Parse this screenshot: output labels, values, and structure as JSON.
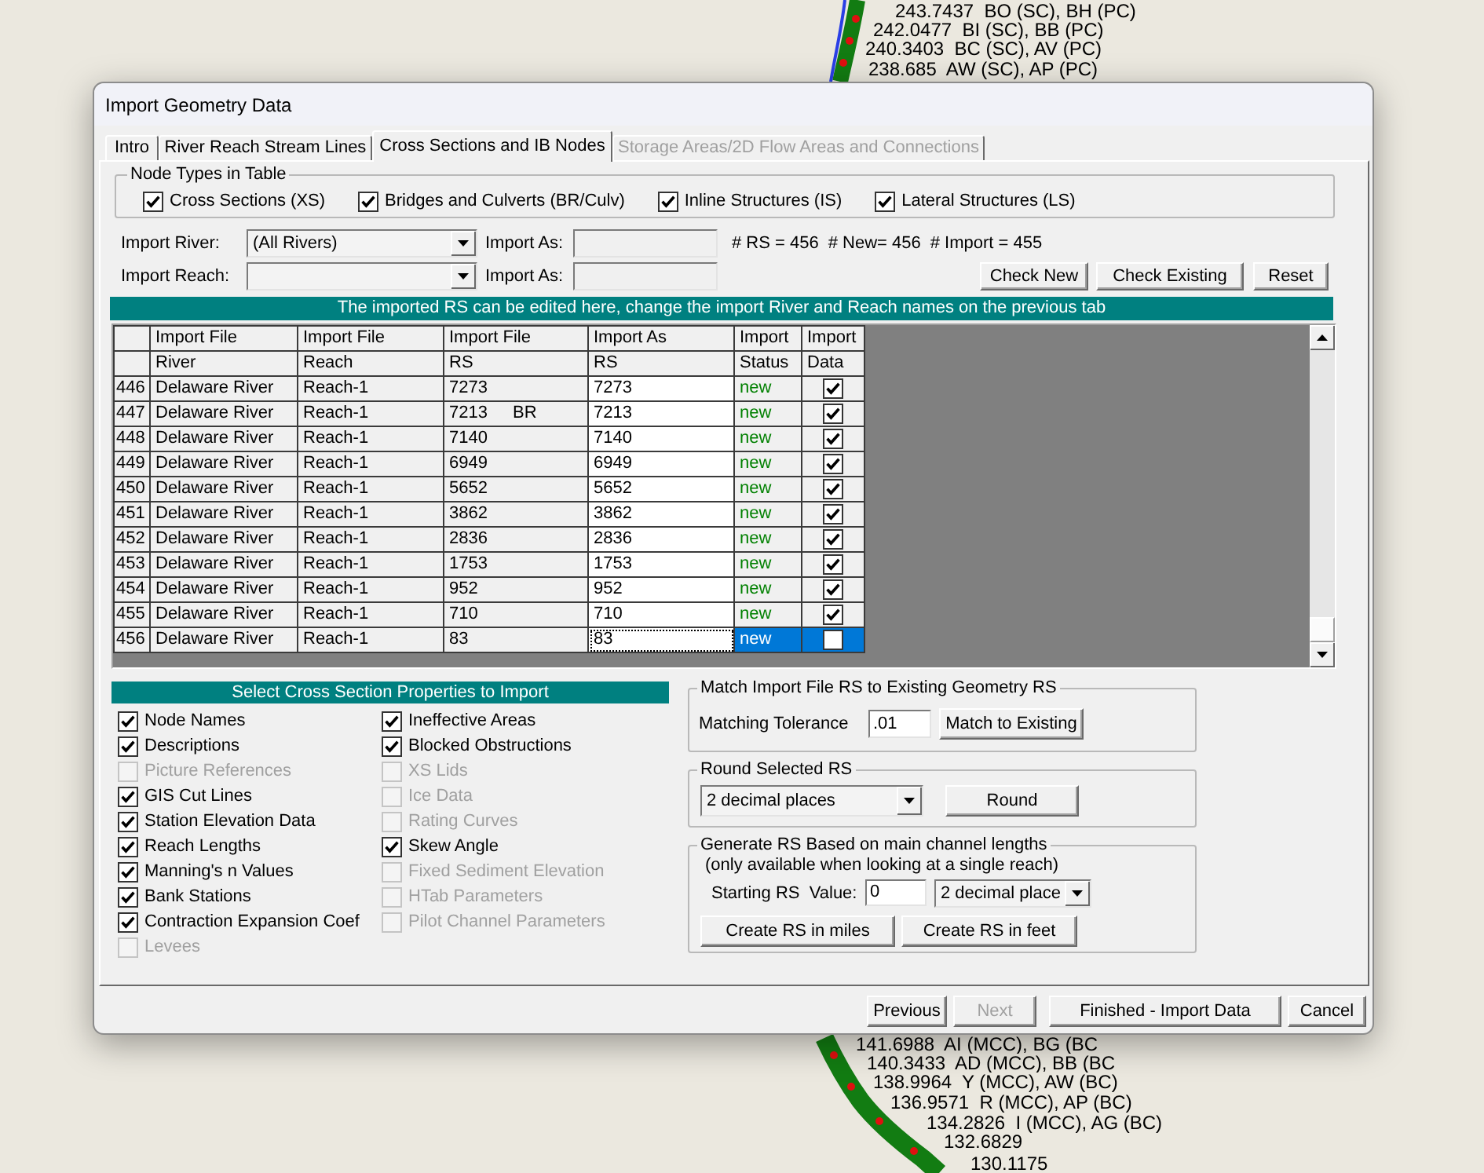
{
  "map": {
    "station_labels": [
      "243.7437  BO (SC), BH (PC)",
      "242.0477  BI (SC), BB (PC)",
      "240.3403  BC (SC), AV (PC)",
      "238.685  AW (SC), AP (PC)",
      "141.6988  AI (MCC), BG (BC",
      "140.3433  AD (MCC), BB (BC",
      "138.9964  Y (MCC), AW (BC)",
      "136.9571  R (MCC), AP (BC)",
      "134.2826  I (MCC), AG (BC)",
      "132.6829",
      "130.1175"
    ]
  },
  "window": {
    "title": "Import Geometry Data"
  },
  "tabs": [
    {
      "label": "Intro",
      "selected": false,
      "disabled": false
    },
    {
      "label": "River Reach Stream Lines",
      "selected": false,
      "disabled": false
    },
    {
      "label": "Cross Sections and IB Nodes",
      "selected": true,
      "disabled": false
    },
    {
      "label": "Storage Areas/2D Flow Areas and Connections",
      "selected": false,
      "disabled": true
    }
  ],
  "node_types": {
    "title": "Node Types in Table",
    "items": [
      {
        "label": "Cross Sections (XS)",
        "checked": true
      },
      {
        "label": "Bridges and Culverts (BR/Culv)",
        "checked": true
      },
      {
        "label": "Inline Structures (IS)",
        "checked": true
      },
      {
        "label": "Lateral Structures (LS)",
        "checked": true
      }
    ]
  },
  "import_river": {
    "label": "Import River:",
    "value": "(All Rivers)",
    "import_as": {
      "label": "Import As:",
      "disabled": true
    }
  },
  "import_reach": {
    "label": "Import Reach:",
    "import_as": {
      "label": "Import As:",
      "disabled": true
    }
  },
  "counts": [
    "# RS = 456",
    "# New= 456",
    "# Import = 455"
  ],
  "action_buttons": [
    "Check New",
    "Check Existing",
    "Reset"
  ],
  "table": {
    "banner": "The imported RS can be edited here, change the import River and Reach names on the previous tab",
    "header_rows": [
      [
        "Import File",
        "Import File",
        "Import File",
        "Import As",
        "Import",
        "Import"
      ],
      [
        "River",
        "Reach",
        "RS",
        "RS",
        "Status",
        "Data"
      ]
    ],
    "rows": [
      {
        "number": "446",
        "river": "Delaware River",
        "reach": "Reach-1",
        "rs": "7273",
        "import_as": "7273",
        "status": "new",
        "import": true,
        "selected": false
      },
      {
        "number": "447",
        "river": "Delaware River",
        "reach": "Reach-1",
        "rs": "7213",
        "node_type": "BR",
        "import_as": "7213",
        "status": "new",
        "import": true,
        "selected": false
      },
      {
        "number": "448",
        "river": "Delaware River",
        "reach": "Reach-1",
        "rs": "7140",
        "import_as": "7140",
        "status": "new",
        "import": true,
        "selected": false
      },
      {
        "number": "449",
        "river": "Delaware River",
        "reach": "Reach-1",
        "rs": "6949",
        "import_as": "6949",
        "status": "new",
        "import": true,
        "selected": false
      },
      {
        "number": "450",
        "river": "Delaware River",
        "reach": "Reach-1",
        "rs": "5652",
        "import_as": "5652",
        "status": "new",
        "import": true,
        "selected": false
      },
      {
        "number": "451",
        "river": "Delaware River",
        "reach": "Reach-1",
        "rs": "3862",
        "import_as": "3862",
        "status": "new",
        "import": true,
        "selected": false
      },
      {
        "number": "452",
        "river": "Delaware River",
        "reach": "Reach-1",
        "rs": "2836",
        "import_as": "2836",
        "status": "new",
        "import": true,
        "selected": false
      },
      {
        "number": "453",
        "river": "Delaware River",
        "reach": "Reach-1",
        "rs": "1753",
        "import_as": "1753",
        "status": "new",
        "import": true,
        "selected": false
      },
      {
        "number": "454",
        "river": "Delaware River",
        "reach": "Reach-1",
        "rs": "952",
        "import_as": "952",
        "status": "new",
        "import": true,
        "selected": false
      },
      {
        "number": "455",
        "river": "Delaware River",
        "reach": "Reach-1",
        "rs": "710",
        "import_as": "710",
        "status": "new",
        "import": true,
        "selected": false
      },
      {
        "number": "456",
        "river": "Delaware River",
        "reach": "Reach-1",
        "rs": "83",
        "import_as": "83",
        "status": "new",
        "import": false,
        "selected": true
      }
    ]
  },
  "properties": {
    "title": "Select Cross Section Properties to Import",
    "columns": [
      [
        {
          "label": "Node Names",
          "checked": true,
          "disabled": false
        },
        {
          "label": "Descriptions",
          "checked": true,
          "disabled": false
        },
        {
          "label": "Picture References",
          "checked": false,
          "disabled": true
        },
        {
          "label": "GIS Cut Lines",
          "checked": true,
          "disabled": false
        },
        {
          "label": "Station Elevation Data",
          "checked": true,
          "disabled": false
        },
        {
          "label": "Reach Lengths",
          "checked": true,
          "disabled": false
        },
        {
          "label": "Manning's n Values",
          "checked": true,
          "disabled": false
        },
        {
          "label": "Bank Stations",
          "checked": true,
          "disabled": false
        },
        {
          "label": "Contraction Expansion Coef",
          "checked": true,
          "disabled": false
        },
        {
          "label": "Levees",
          "checked": false,
          "disabled": true
        }
      ],
      [
        {
          "label": "Ineffective Areas",
          "checked": true,
          "disabled": false
        },
        {
          "label": "Blocked Obstructions",
          "checked": true,
          "disabled": false
        },
        {
          "label": "XS Lids",
          "checked": false,
          "disabled": true
        },
        {
          "label": "Ice Data",
          "checked": false,
          "disabled": true
        },
        {
          "label": "Rating Curves",
          "checked": false,
          "disabled": true
        },
        {
          "label": "Skew Angle",
          "checked": true,
          "disabled": false
        },
        {
          "label": "Fixed Sediment Elevation",
          "checked": false,
          "disabled": true
        },
        {
          "label": "HTab Parameters",
          "checked": false,
          "disabled": true
        },
        {
          "label": "Pilot Channel Parameters",
          "checked": false,
          "disabled": true
        }
      ]
    ]
  },
  "match_group": {
    "title": "Match Import File RS to Existing Geometry RS",
    "tolerance_label": "Matching Tolerance",
    "tolerance_value": ".01",
    "button": "Match to Existing"
  },
  "round_group": {
    "title": "Round Selected RS",
    "select_value": "2 decimal places",
    "button": "Round"
  },
  "generate_group": {
    "title": "Generate RS Based on main channel lengths",
    "note": "(only available when looking at a single reach)",
    "start_label": "Starting RS  Value:",
    "start_value": "0",
    "decimal_select": "2 decimal place",
    "buttons": [
      "Create RS in miles",
      "Create RS in feet"
    ]
  },
  "footer_buttons": [
    {
      "label": "Previous",
      "disabled": false
    },
    {
      "label": "Next",
      "disabled": true
    },
    {
      "label": "Finished - Import Data",
      "disabled": false
    },
    {
      "label": "Cancel",
      "disabled": false
    }
  ]
}
